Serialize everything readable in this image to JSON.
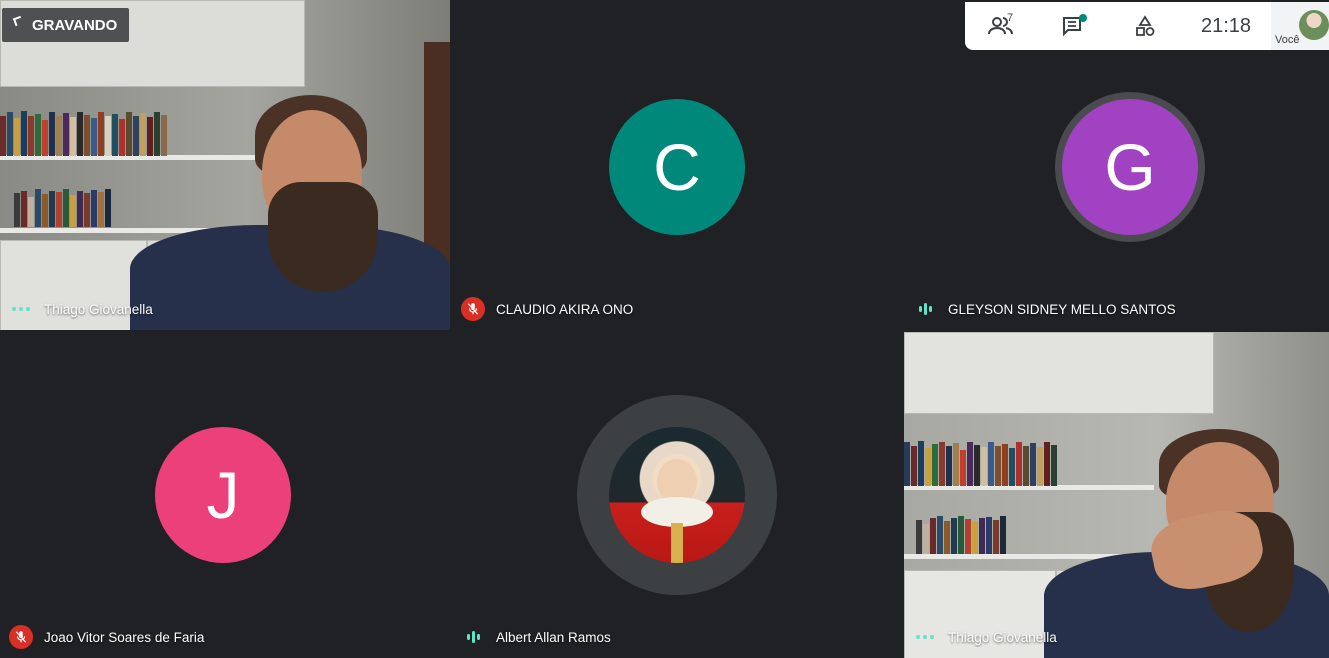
{
  "recording": {
    "label": "GRAVANDO"
  },
  "topbar": {
    "participants_count": "7",
    "time": "21:18",
    "you_label": "Você",
    "icons": [
      "people-icon",
      "chat-icon",
      "activities-icon"
    ]
  },
  "tiles": [
    {
      "name": "Thiago Giovanella",
      "type": "video",
      "indicator": "dots"
    },
    {
      "name": "CLAUDIO AKIRA ONO",
      "type": "avatar",
      "initial": "C",
      "avatar_color": "#00897b",
      "indicator": "muted"
    },
    {
      "name": "GLEYSON SIDNEY MELLO SANTOS",
      "type": "avatar",
      "initial": "G",
      "avatar_color": "#a142c2",
      "indicator": "speaking"
    },
    {
      "name": "Joao Vitor Soares de Faria",
      "type": "avatar",
      "initial": "J",
      "avatar_color": "#ec407a",
      "indicator": "muted"
    },
    {
      "name": "Albert Allan Ramos",
      "type": "photo-avatar",
      "indicator": "speaking"
    },
    {
      "name": "Thiago Giovanella",
      "type": "video",
      "indicator": "dots"
    }
  ]
}
